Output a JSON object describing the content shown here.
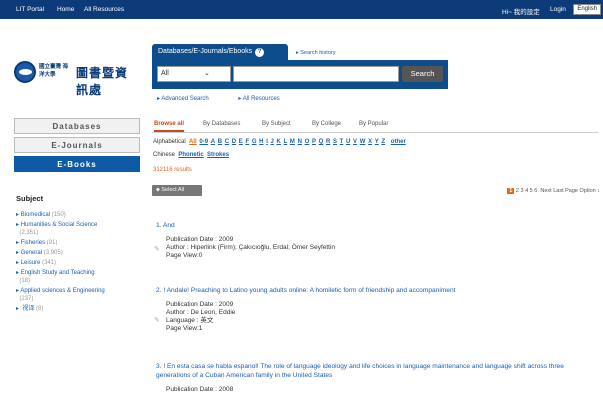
{
  "topbar": {
    "portal": "LIT Portal",
    "home": "Home",
    "all_resources": "All Resources",
    "account": "Hi~ 我的設定",
    "login": "Login",
    "language": "English"
  },
  "logo": {
    "small_text": "國立臺灣 海洋大學",
    "big_text": "圖書暨資訊處"
  },
  "search": {
    "tab_label": "Databases/E-Journals/Ebooks",
    "history": "Search history",
    "select_value": "All",
    "button": "Search",
    "advanced": "Advanced Search",
    "all_resources": "All Resources"
  },
  "sidebar": {
    "tabs": [
      "Databases",
      "E-Journals",
      "E-Books"
    ],
    "subject_title": "Subject",
    "subjects": [
      {
        "label": "Biomedical",
        "count": "(150)"
      },
      {
        "label": "Humanities & Social Science",
        "count": "(2,351)"
      },
      {
        "label": "Fisheries",
        "count": "(91)"
      },
      {
        "label": "General",
        "count": "(3,905)"
      },
      {
        "label": "Leisure",
        "count": "(341)"
      },
      {
        "label": "English Study and Teaching",
        "count": "(18)"
      },
      {
        "label": "Applied sciences & Engineering",
        "count": "(237)"
      },
      {
        "label": "视译",
        "count": "(8)"
      }
    ]
  },
  "browse_tabs": [
    "Browse all",
    "By Databases",
    "By Subject",
    "By College",
    "By Popular"
  ],
  "alphabet": {
    "label": "Alphabetical",
    "letters": [
      "All",
      "0-9",
      "A",
      "B",
      "C",
      "D",
      "E",
      "F",
      "G",
      "H",
      "I",
      "J",
      "K",
      "L",
      "M",
      "N",
      "O",
      "P",
      "Q",
      "R",
      "S",
      "T",
      "U",
      "V",
      "W",
      "X",
      "Y",
      "Z",
      "other"
    ]
  },
  "chinese": {
    "label": "Chinese",
    "phonetic": "Phonetic",
    "strokes": "Strokes"
  },
  "results": "312116 results",
  "select_all": "Select All",
  "pager": {
    "current": "1",
    "pages": "2  3  4  5  6",
    "rest": "Next  Last Page  Option ↓"
  },
  "items": [
    {
      "title": "1. And",
      "date": "Publication Date : 2009",
      "author": "Author : Hiperlink (Firm); Çakıcıoğlu, Erdal; Ömer Seyfettin",
      "views": "Page View:0"
    },
    {
      "title": "2. ! Andale! Preaching to Latino young adults online: A homiletic form of friendship and accompaniment",
      "date": "Publication Date : 2009",
      "author": "Author : De Leon, Eddie",
      "language": "Language : 英文",
      "views": "Page View:1"
    },
    {
      "title": "3. ! En esta casa se habla espanol! The role of language ideology and life choices in language maintenance and language shift across three generations of a Cuban American family in the United States",
      "date": "Publication Date : 2008"
    }
  ]
}
